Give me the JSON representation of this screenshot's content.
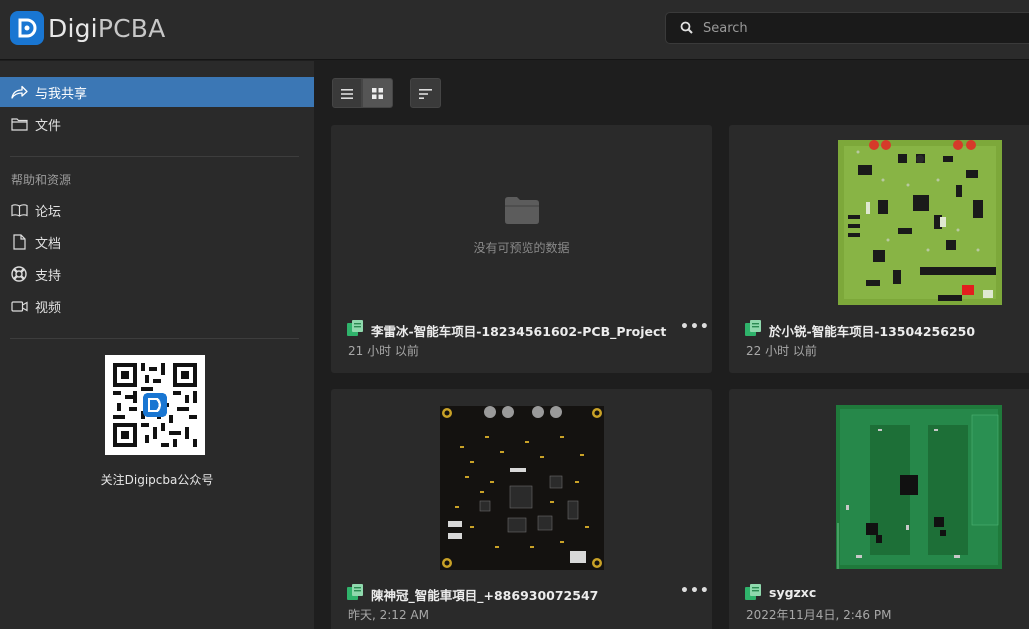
{
  "header": {
    "logo_prefix": "Digi",
    "logo_suffix": "PCBA",
    "search_placeholder": "Search"
  },
  "sidebar": {
    "items": [
      {
        "label": "与我共享",
        "icon": "share-icon",
        "active": true
      },
      {
        "label": "文件",
        "icon": "folder-icon",
        "active": false
      }
    ],
    "help_section_label": "帮助和资源",
    "help_items": [
      {
        "label": "论坛",
        "icon": "book-icon"
      },
      {
        "label": "文档",
        "icon": "document-icon"
      },
      {
        "label": "支持",
        "icon": "lifebuoy-icon"
      },
      {
        "label": "视频",
        "icon": "video-icon"
      }
    ],
    "qr_caption": "关注Digipcba公众号"
  },
  "main": {
    "cards": [
      {
        "title": "李雷冰-智能车项目-18234561602-PCB_Project",
        "time": "21 小时 以前",
        "empty_text": "没有可预览的数据",
        "more": "•••"
      },
      {
        "title": "於小锐-智能车项目-13504256250",
        "time": "22 小时 以前",
        "more": "•••"
      },
      {
        "title": "陳神冠_智能車項目_+886930072547",
        "time": "昨天, 2:12 AM",
        "more": "•••"
      },
      {
        "title": "sygzxc",
        "time": "2022年11月4日, 2:46 PM",
        "more": "•••"
      }
    ]
  },
  "colors": {
    "accent": "#3b77b5",
    "logo_blue": "#1976d2",
    "file_icon_green": "#2fb36b"
  }
}
